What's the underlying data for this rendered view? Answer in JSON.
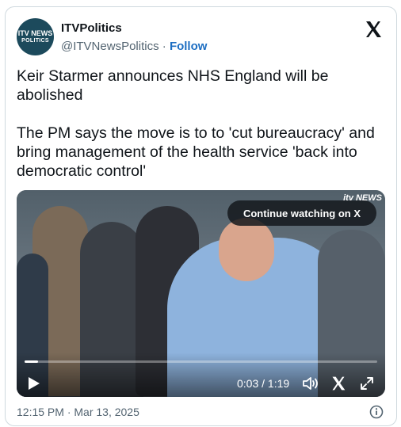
{
  "author": {
    "name": "ITVPolitics",
    "handle": "@ITVNewsPolitics",
    "separator": "·",
    "follow_label": "Follow",
    "avatar_line1": "ITV NEWS",
    "avatar_line2": "POLITICS"
  },
  "tweet": {
    "paragraph1": "Keir Starmer announces NHS England will be abolished",
    "paragraph2": "The PM says the move is to to 'cut bureaucracy' and bring management of the health service 'back into democratic control'"
  },
  "video": {
    "brand": "itv NEWS",
    "continue_label": "Continue watching on X",
    "time_label": "0:03 / 1:19",
    "progress_fraction": 0.038
  },
  "footer": {
    "timestamp": "12:15 PM · Mar 13, 2025"
  },
  "icons": {
    "x_logo": "x-logo-icon",
    "play": "play-icon",
    "volume": "volume-icon",
    "fullscreen": "fullscreen-icon",
    "info": "info-icon"
  }
}
